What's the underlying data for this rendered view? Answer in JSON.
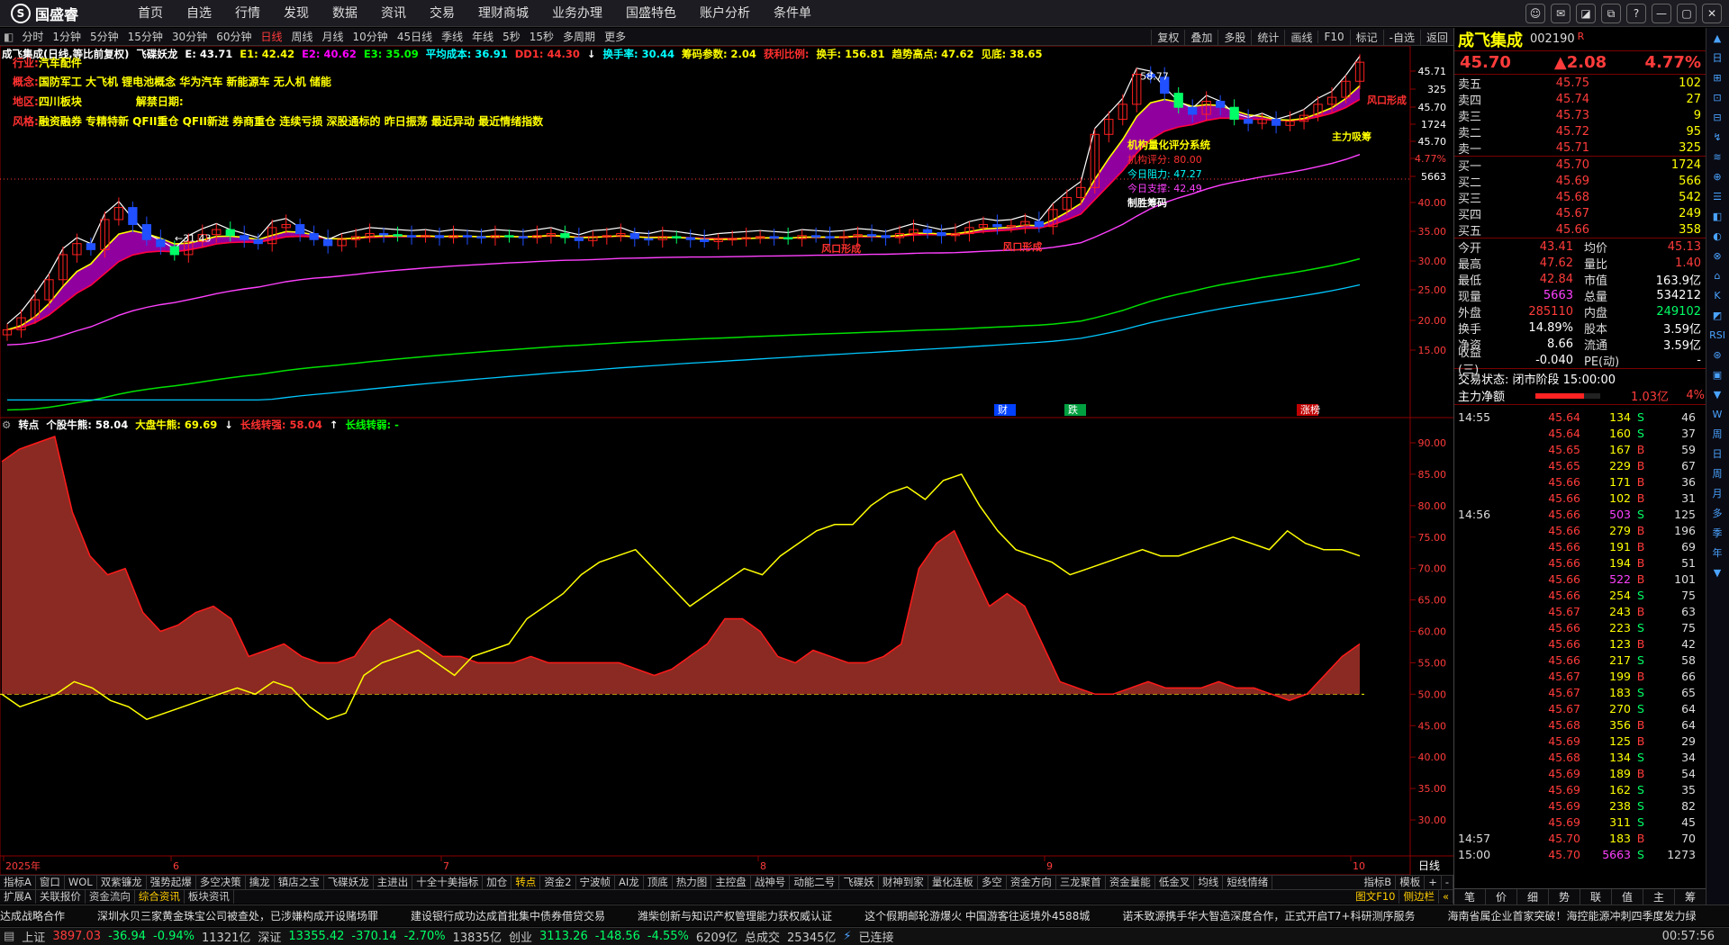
{
  "app": {
    "logo": "国盛睿",
    "menu": [
      "首页",
      "自选",
      "行情",
      "发现",
      "数据",
      "资讯",
      "交易",
      "理财商城",
      "业务办理",
      "国盛特色",
      "账户分析",
      "条件单"
    ],
    "win_icons": [
      "chat-icon",
      "mail-icon",
      "minimize-window-icon",
      "restore-icon",
      "help-icon",
      "minimize-icon",
      "maximize-icon",
      "close-icon"
    ],
    "win_glyphs": [
      "☺",
      "✉",
      "◪",
      "⧉",
      "?",
      "—",
      "▢",
      "✕"
    ]
  },
  "periods": [
    "分时",
    "1分钟",
    "5分钟",
    "15分钟",
    "30分钟",
    "60分钟",
    "日线",
    "周线",
    "月线",
    "10分钟",
    "45日线",
    "季线",
    "年线",
    "5秒",
    "15秒",
    "多周期",
    "更多"
  ],
  "period_active": "日线",
  "tools": [
    "复权",
    "叠加",
    "多股",
    "统计",
    "画线",
    "F10",
    "标记",
    "-自选",
    "返回"
  ],
  "indicator_line": [
    {
      "t": "成飞集成(日线,等比前复权)",
      "c": "#ffffff"
    },
    {
      "t": "飞碟妖龙",
      "c": "#ffffff"
    },
    {
      "t": "E: 43.71",
      "c": "#ffffff"
    },
    {
      "t": "E1: 42.42",
      "c": "#ffff00"
    },
    {
      "t": "E2: 40.62",
      "c": "#ff00ff"
    },
    {
      "t": "E3: 35.09",
      "c": "#00ff00"
    },
    {
      "t": "平均成本: 36.91",
      "c": "#00ffff"
    },
    {
      "t": "DD1: 44.30",
      "c": "#ff3030"
    },
    {
      "t": "↓",
      "c": "#ffffff"
    },
    {
      "t": "换手率: 30.44",
      "c": "#00ffff"
    },
    {
      "t": "筹码参数: 2.04",
      "c": "#ffff00"
    },
    {
      "t": "获利比例:",
      "c": "#ff3030"
    },
    {
      "t": "换手: 156.81",
      "c": "#ffff00"
    },
    {
      "t": "趋势高点: 47.62",
      "c": "#ffff00"
    },
    {
      "t": "见底: 38.65",
      "c": "#ffff00"
    }
  ],
  "info": {
    "industry_label": "行业:",
    "industry": "汽车配件",
    "concept_label": "概念:",
    "concept": "国防军工 大飞机 锂电池概念 华为汽车 新能源车 无人机 储能",
    "region_label": "地区:",
    "region": "四川板块",
    "unlock_label": "解禁日期:",
    "style_label": "风格:",
    "style": "融资融券 专精特新 QFII重仓 QFII新进 券商重仓 连续亏损 深股通标的 昨日振荡 最近异动 最近情绪指数"
  },
  "quant": {
    "title": "机构量化评分系统",
    "score": "机构评分: 80.00",
    "resist": "今日阻力: 47.27",
    "support": "今日支撑: 42.49",
    "flag": "制胜筹码"
  },
  "chart_annotations": {
    "high": "58.77",
    "low": "←31.43",
    "tag_cai": "财",
    "tag_die": "跌",
    "tag_zhangting": "涨榜",
    "fk": "风口形成",
    "fk2": "风口形成",
    "fk3": "风口形成",
    "zlxc": "主力吸筹"
  },
  "price_axis": [
    "45.71",
    "325",
    "45.70",
    "1724",
    "45.70",
    "4.77%",
    "5663",
    "40.00",
    "35.00",
    "30.00",
    "25.00",
    "20.00",
    "15.00"
  ],
  "x_axis": [
    "2025年",
    "6",
    "7",
    "8",
    "9",
    "10"
  ],
  "x_axis_right": "日线",
  "sub_line": [
    {
      "t": "转点",
      "c": "#ffffff"
    },
    {
      "t": "个股牛熊: 58.04",
      "c": "#ffffff"
    },
    {
      "t": "大盘牛熊: 69.69",
      "c": "#ffff00"
    },
    {
      "t": "↓",
      "c": "#ffffff"
    },
    {
      "t": "长线转强: 58.04",
      "c": "#ff3030"
    },
    {
      "t": "↑",
      "c": "#ffffff"
    },
    {
      "t": "长线转弱: -",
      "c": "#00ff00"
    }
  ],
  "sub_axis": [
    "90.00",
    "85.00",
    "80.00",
    "75.00",
    "70.00",
    "65.00",
    "60.00",
    "55.00",
    "50.00",
    "45.00",
    "40.00",
    "35.00",
    "30.00"
  ],
  "chart_data": [
    {
      "type": "candlestick",
      "title": "成飞集成(日线,等比前复权)",
      "x_ticks": [
        "2025年",
        "6",
        "7",
        "8",
        "9",
        "10"
      ],
      "ylim": [
        15,
        45.71
      ],
      "close_approx": [
        19.0,
        20.2,
        22.0,
        24.0,
        26.5,
        27.6,
        27.0,
        30.0,
        31.2,
        29.5,
        28.0,
        27.3,
        26.5,
        27.8,
        28.5,
        29.0,
        28.4,
        28.0,
        27.6,
        29.2,
        29.5,
        28.6,
        28.0,
        27.4,
        28.0,
        28.3,
        28.6,
        28.5,
        28.4,
        28.3,
        28.4,
        28.2,
        28.4,
        28.3,
        28.2,
        28.4,
        28.3,
        28.2,
        28.4,
        28.6,
        28.2,
        27.9,
        28.3,
        28.4,
        28.6,
        28.1,
        28.0,
        28.3,
        28.2,
        28.0,
        27.8,
        28.0,
        28.1,
        28.2,
        28.3,
        28.2,
        28.1,
        28.4,
        28.3,
        28.2,
        28.3,
        28.5,
        28.4,
        28.2,
        28.6,
        29.0,
        28.7,
        28.4,
        28.6,
        29.2,
        29.5,
        29.3,
        29.4,
        29.8,
        29.3,
        31.0,
        32.2,
        33.2,
        38.5,
        40.0,
        41.5,
        44.5,
        44.2,
        42.6,
        41.2,
        40.5,
        41.8,
        41.2,
        40.0,
        39.6,
        40.0,
        39.4,
        39.8,
        40.4,
        41.5,
        42.2,
        43.8,
        45.7
      ],
      "series": [
        {
          "name": "E",
          "value": 43.71
        },
        {
          "name": "E1",
          "value": 42.42
        },
        {
          "name": "E2",
          "value": 40.62
        },
        {
          "name": "E3",
          "value": 35.09
        },
        {
          "name": "平均成本",
          "value": 36.91
        }
      ],
      "high": 58.77,
      "low": 31.43
    },
    {
      "type": "area",
      "title": "转点",
      "ylim": [
        30,
        90
      ],
      "baseline": 50,
      "series": [
        {
          "name": "个股牛熊",
          "color": "#ff1a1a",
          "values": [
            87,
            89,
            90,
            91,
            79,
            72,
            69,
            70,
            63,
            60,
            61,
            63,
            64,
            62,
            56,
            57,
            58,
            56,
            55,
            55,
            56,
            60,
            62,
            60,
            58,
            56,
            56,
            55,
            55,
            55,
            56,
            55,
            55,
            55,
            55,
            55,
            54,
            53,
            54,
            56,
            58,
            62,
            62,
            60,
            56,
            55,
            57,
            56,
            55,
            55,
            56,
            58,
            70,
            74,
            76,
            70,
            64,
            66,
            64,
            58,
            52,
            51,
            50,
            50,
            51,
            52,
            51,
            51,
            51,
            52,
            51,
            51,
            50,
            49,
            50,
            53,
            56,
            58
          ]
        },
        {
          "name": "大盘牛熊",
          "color": "#ffff00",
          "values": [
            50,
            48,
            49,
            50,
            52,
            51,
            49,
            48,
            46,
            47,
            48,
            49,
            50,
            51,
            50,
            52,
            51,
            48,
            46,
            47,
            53,
            55,
            56,
            57,
            55,
            53,
            56,
            57,
            58,
            62,
            64,
            66,
            69,
            71,
            72,
            73,
            70,
            67,
            64,
            66,
            68,
            70,
            69,
            72,
            74,
            76,
            77,
            77,
            80,
            82,
            83,
            81,
            84,
            85,
            80,
            76,
            73,
            72,
            71,
            69,
            70,
            71,
            72,
            73,
            72,
            72,
            73,
            74,
            75,
            74,
            73,
            76,
            74,
            73,
            73,
            72
          ]
        }
      ]
    }
  ],
  "bottom_tabs1": [
    "指标A",
    "窗口",
    "WOL",
    "双紫镰龙",
    "强势起爆",
    "多空决策",
    "擒龙",
    "镇店之宝",
    "飞碟妖龙",
    "主进出",
    "十全十美指标",
    "加仓",
    "转点",
    "资金2",
    "宁波帧",
    "AI龙",
    "顶底",
    "热力图",
    "主控盘",
    "战神号",
    "动能二号",
    "飞碟妖",
    "财神到家",
    "量化连板",
    "多空",
    "资金方向",
    "三龙聚首",
    "资金量能",
    "低金叉",
    "均线",
    "短线情绪"
  ],
  "bottom_tabs1_active": "转点",
  "bottom_tabs1_right": [
    "指标B",
    "模板",
    "+",
    "-"
  ],
  "bottom_tabs2": [
    "扩展A",
    "关联报价",
    "资金流向",
    "综合资讯",
    "板块资讯"
  ],
  "bottom_tabs2_active": "综合资讯",
  "bottom_tabs2_right": [
    "图文F10",
    "侧边栏",
    "«"
  ],
  "news": [
    "达成战略合作",
    "深圳水贝三家黄金珠宝公司被查处，已涉嫌构成开设赌场罪",
    "建设银行成功达成首批集中债券借贷交易",
    "潍柴创新与知识产权管理能力获权威认证",
    "这个假期邮轮游爆火 中国游客往返境外4588城",
    "诺禾致源携手华大智造深度合作，正式开启T7+科研测序服务",
    "海南省属企业首家突破！海控能源冲刺四季度发力绿"
  ],
  "statusbar": {
    "sh_label": "上证",
    "sh": "3897.03",
    "sh_chg": "-36.94",
    "sh_pct": "-0.94%",
    "sh_amt": "11321亿",
    "sz_label": "深证",
    "sz": "13355.42",
    "sz_chg": "-370.14",
    "sz_pct": "-2.70%",
    "sz_amt": "13835亿",
    "cy_label": "创业",
    "cy": "3113.26",
    "cy_chg": "-148.56",
    "cy_pct": "-4.55%",
    "cy_amt": "6209亿",
    "total_label": "总成交",
    "total": "25345亿",
    "conn": "已连接",
    "time": "00:57:56"
  },
  "stock": {
    "name": "成飞集成",
    "code": "002190",
    "tag": "R",
    "price": "45.70",
    "change": "▲2.08",
    "pct": "4.77%"
  },
  "asks": [
    {
      "l": "卖五",
      "p": "45.75",
      "v": "102"
    },
    {
      "l": "卖四",
      "p": "45.74",
      "v": "27"
    },
    {
      "l": "卖三",
      "p": "45.73",
      "v": "9"
    },
    {
      "l": "卖二",
      "p": "45.72",
      "v": "95"
    },
    {
      "l": "卖一",
      "p": "45.71",
      "v": "325"
    }
  ],
  "bids": [
    {
      "l": "买一",
      "p": "45.70",
      "v": "1724"
    },
    {
      "l": "买二",
      "p": "45.69",
      "v": "566"
    },
    {
      "l": "买三",
      "p": "45.68",
      "v": "542"
    },
    {
      "l": "买四",
      "p": "45.67",
      "v": "249"
    },
    {
      "l": "买五",
      "p": "45.66",
      "v": "358"
    }
  ],
  "stats": [
    {
      "a": "今开",
      "av": "43.41",
      "ac": "#ff3b3b",
      "b": "均价",
      "bv": "45.13",
      "bc": "#ff3b3b"
    },
    {
      "a": "最高",
      "av": "47.62",
      "ac": "#ff3b3b",
      "b": "量比",
      "bv": "1.40",
      "bc": "#ff3b3b"
    },
    {
      "a": "最低",
      "av": "42.84",
      "ac": "#ff3b3b",
      "b": "市值",
      "bv": "163.9亿",
      "bc": "#ffffff"
    },
    {
      "a": "现量",
      "av": "5663",
      "ac": "#ff40ff",
      "b": "总量",
      "bv": "534212",
      "bc": "#ffffff"
    },
    {
      "a": "外盘",
      "av": "285110",
      "ac": "#ff3b3b",
      "b": "内盘",
      "bv": "249102",
      "bc": "#00ff66"
    },
    {
      "a": "换手",
      "av": "14.89%",
      "ac": "#ffffff",
      "b": "股本",
      "bv": "3.59亿",
      "bc": "#ffffff"
    },
    {
      "a": "净资",
      "av": "8.66",
      "ac": "#ffffff",
      "b": "流通",
      "bv": "3.59亿",
      "bc": "#ffffff"
    },
    {
      "a": "收益(三)",
      "av": "-0.040",
      "ac": "#ffffff",
      "b": "PE(动)",
      "bv": "-",
      "bc": "#ffffff"
    }
  ],
  "trade_state": "交易状态: 闭市阶段 15:00:00",
  "main_net_label": "主力净额",
  "main_net": "1.03亿",
  "main_net_pct": "4%",
  "main_net_fraction": 0.75,
  "ticks": [
    {
      "t": "14:55",
      "p": "45.64",
      "v": "134",
      "d": "S",
      "n": "46"
    },
    {
      "t": "",
      "p": "45.64",
      "v": "160",
      "d": "S",
      "n": "37"
    },
    {
      "t": "",
      "p": "45.65",
      "v": "167",
      "d": "B",
      "n": "59"
    },
    {
      "t": "",
      "p": "45.65",
      "v": "229",
      "d": "B",
      "n": "67"
    },
    {
      "t": "",
      "p": "45.66",
      "v": "171",
      "d": "B",
      "n": "36"
    },
    {
      "t": "",
      "p": "45.66",
      "v": "102",
      "d": "B",
      "n": "31"
    },
    {
      "t": "14:56",
      "p": "45.66",
      "v": "503",
      "d": "S",
      "n": "125"
    },
    {
      "t": "",
      "p": "45.66",
      "v": "279",
      "d": "B",
      "n": "196"
    },
    {
      "t": "",
      "p": "45.66",
      "v": "191",
      "d": "B",
      "n": "69"
    },
    {
      "t": "",
      "p": "45.66",
      "v": "194",
      "d": "B",
      "n": "51"
    },
    {
      "t": "",
      "p": "45.66",
      "v": "522",
      "d": "B",
      "n": "101"
    },
    {
      "t": "",
      "p": "45.66",
      "v": "254",
      "d": "S",
      "n": "75"
    },
    {
      "t": "",
      "p": "45.67",
      "v": "243",
      "d": "B",
      "n": "63"
    },
    {
      "t": "",
      "p": "45.66",
      "v": "223",
      "d": "S",
      "n": "75"
    },
    {
      "t": "",
      "p": "45.66",
      "v": "123",
      "d": "B",
      "n": "42"
    },
    {
      "t": "",
      "p": "45.66",
      "v": "217",
      "d": "S",
      "n": "58"
    },
    {
      "t": "",
      "p": "45.67",
      "v": "199",
      "d": "B",
      "n": "66"
    },
    {
      "t": "",
      "p": "45.67",
      "v": "183",
      "d": "S",
      "n": "65"
    },
    {
      "t": "",
      "p": "45.67",
      "v": "270",
      "d": "S",
      "n": "64"
    },
    {
      "t": "",
      "p": "45.68",
      "v": "356",
      "d": "B",
      "n": "64"
    },
    {
      "t": "",
      "p": "45.69",
      "v": "125",
      "d": "B",
      "n": "29"
    },
    {
      "t": "",
      "p": "45.68",
      "v": "134",
      "d": "S",
      "n": "34"
    },
    {
      "t": "",
      "p": "45.69",
      "v": "189",
      "d": "B",
      "n": "54"
    },
    {
      "t": "",
      "p": "45.69",
      "v": "162",
      "d": "S",
      "n": "35"
    },
    {
      "t": "",
      "p": "45.69",
      "v": "238",
      "d": "S",
      "n": "82"
    },
    {
      "t": "",
      "p": "45.69",
      "v": "311",
      "d": "S",
      "n": "45"
    },
    {
      "t": "14:57",
      "p": "45.70",
      "v": "183",
      "d": "B",
      "n": "70"
    },
    {
      "t": "15:00",
      "p": "45.70",
      "v": "5663",
      "d": "S",
      "n": "1273"
    }
  ],
  "right_bottom_tabs": [
    "笔",
    "价",
    "细",
    "势",
    "联",
    "值",
    "主",
    "筹"
  ],
  "sidebar": [
    "▲",
    "日",
    "⊞",
    "⊡",
    "⊟",
    "↯",
    "≋",
    "⊕",
    "☰",
    "◧",
    "◐",
    "⊗",
    "⌂",
    "K",
    "◩",
    "RSI",
    "⊛",
    "▣",
    "▼",
    "W",
    "周",
    "日",
    "周",
    "月",
    "多",
    "季",
    "年",
    "▼"
  ]
}
